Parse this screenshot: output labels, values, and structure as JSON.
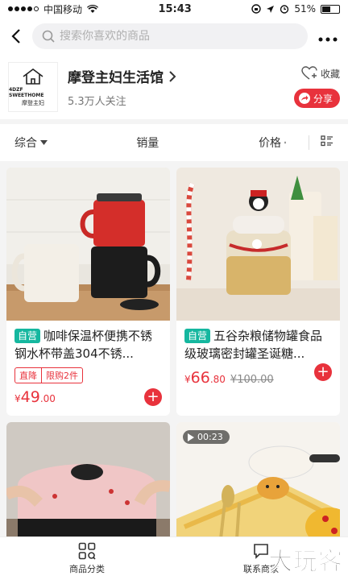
{
  "status_bar": {
    "carrier": "中国移动",
    "time": "15:43",
    "battery": "51%"
  },
  "header": {
    "search_placeholder": "搜索你喜欢的商品"
  },
  "shop": {
    "logo_line1": "4DZF SWEETHOME",
    "logo_line2": "摩登主妇",
    "name": "摩登主妇生活馆",
    "followers": "5.3万人关注",
    "favorite_label": "收藏",
    "share_label": "分享"
  },
  "sort_tabs": {
    "all": "综合",
    "sales": "销量",
    "price": "价格"
  },
  "colors": {
    "accent": "#e8323c",
    "self_badge": "#15b79f"
  },
  "products": [
    {
      "badge": "自营",
      "title": "咖啡保温杯便携不锈钢水杯带盖304不锈...",
      "promo": [
        "直降",
        "限购2件"
      ],
      "currency": "¥",
      "price_int": "49",
      "price_dec": ".00",
      "old_price": ""
    },
    {
      "badge": "自营",
      "title": "五谷杂粮储物罐食品级玻璃密封罐圣诞糖...",
      "promo": [],
      "currency": "¥",
      "price_int": "66",
      "price_dec": ".80",
      "old_price": "¥100.00"
    },
    {
      "video_duration": "00:23"
    },
    {}
  ],
  "bottom_nav": {
    "categories": "商品分类",
    "contact": "联系商家"
  },
  "watermark": "大玩客"
}
